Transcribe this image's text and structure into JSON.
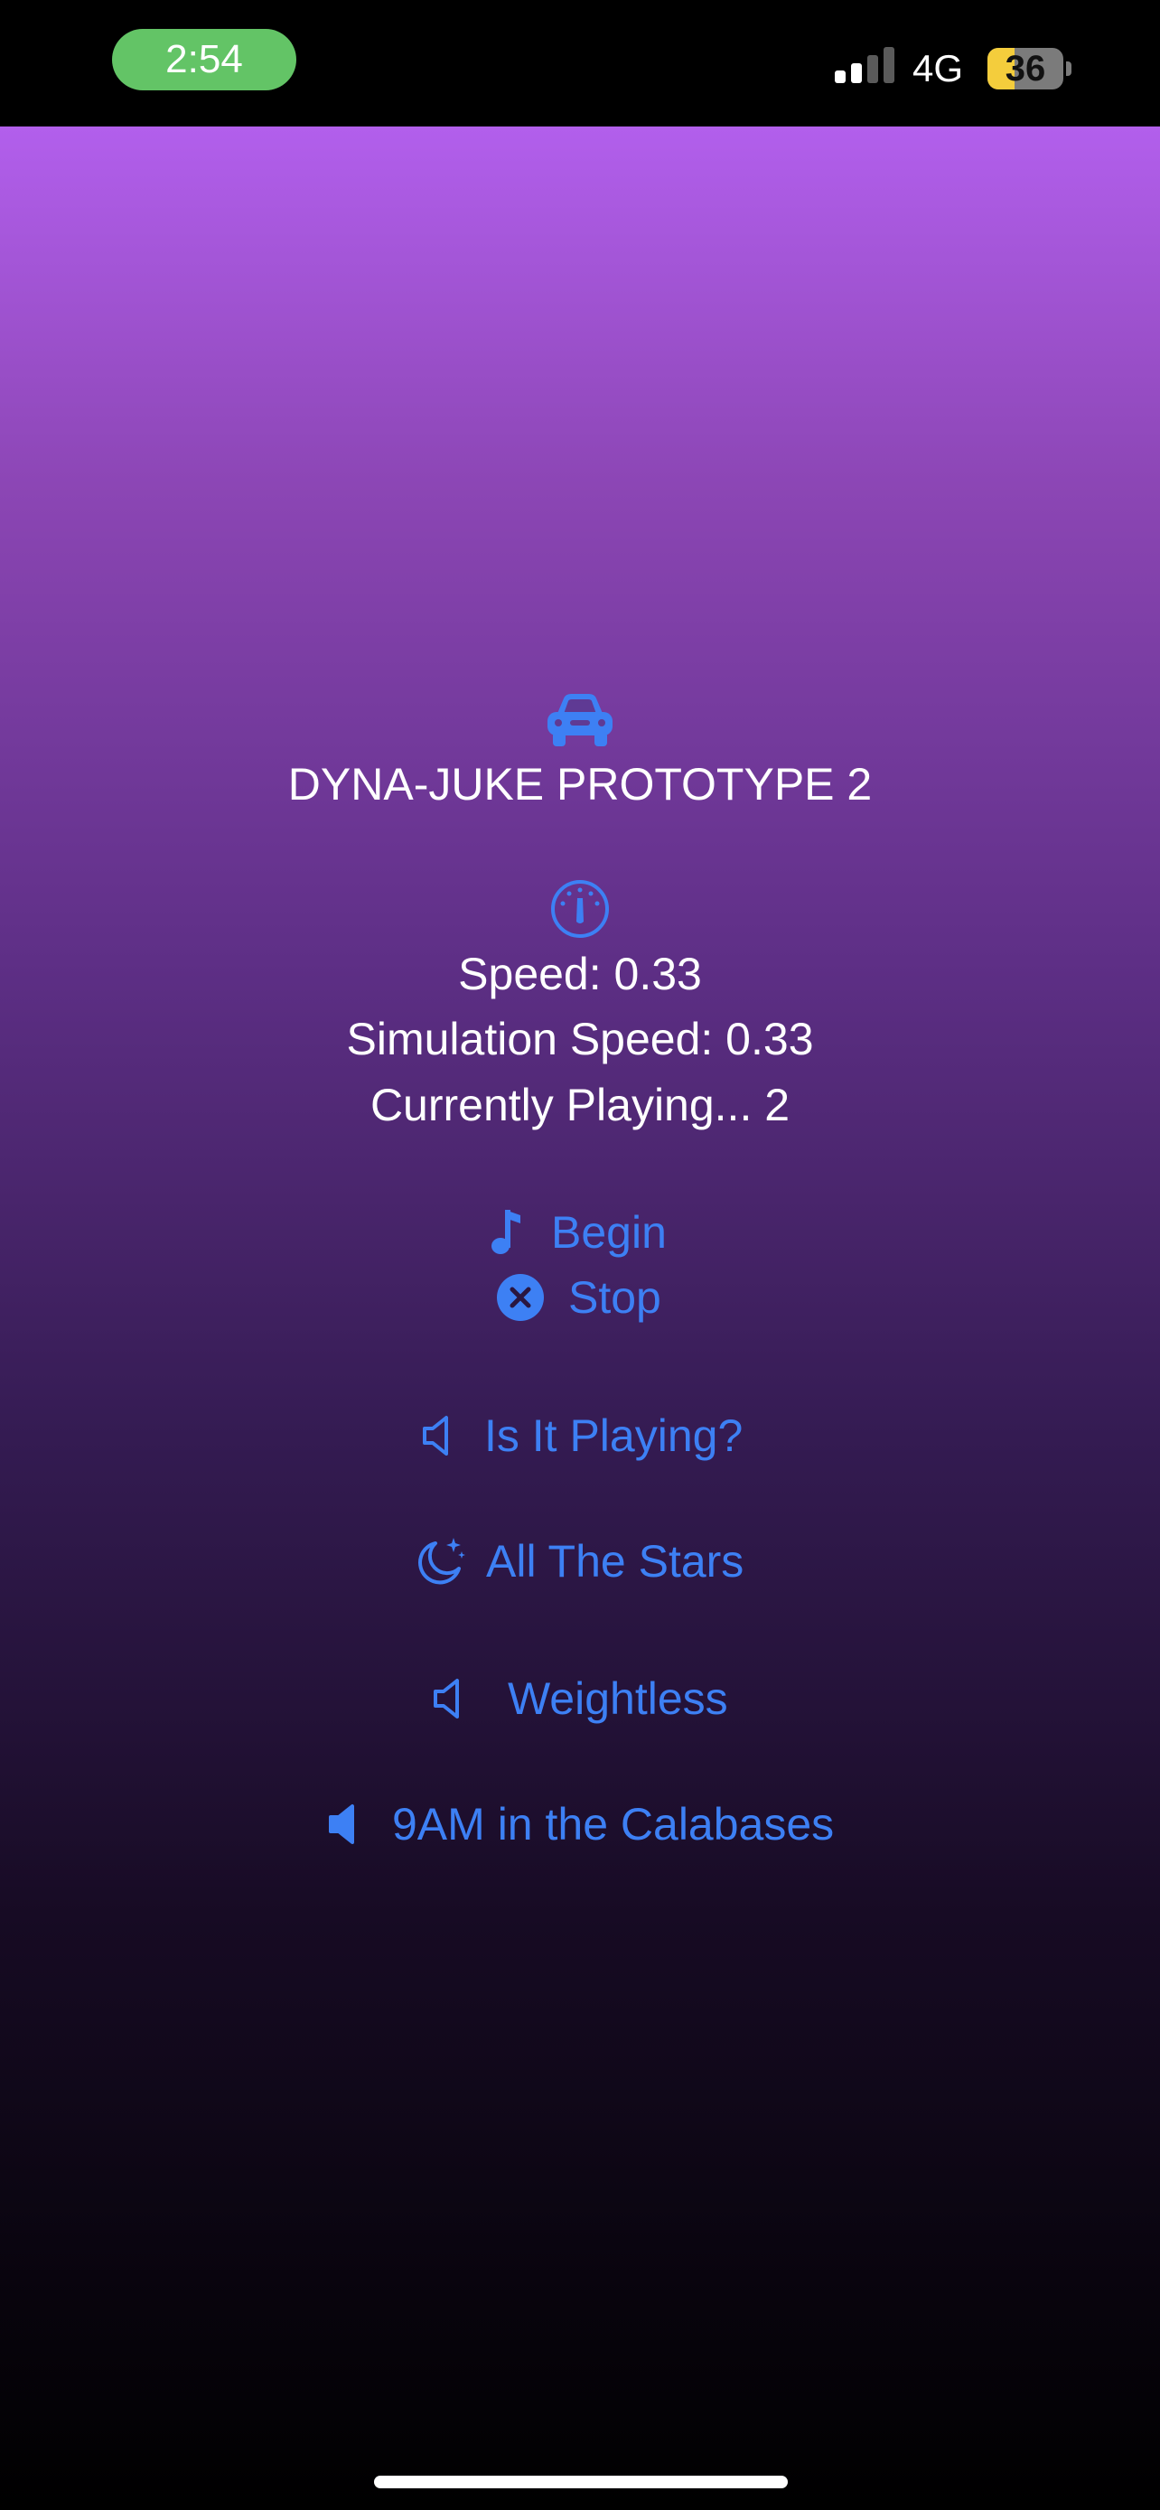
{
  "status_bar": {
    "time": "2:54",
    "network": "4G",
    "battery_level": "36"
  },
  "header": {
    "icon": "car-icon",
    "title": "DYNA-JUKE PROTOTYPE 2"
  },
  "stats": {
    "icon": "gauge-icon",
    "speed": "Speed: 0.33",
    "simulation_speed": "Simulation Speed: 0.33",
    "currently_playing": "Currently Playing... 2"
  },
  "controls": {
    "begin_label": "Begin",
    "begin_icon": "music-note-icon",
    "stop_label": "Stop",
    "stop_icon": "close-circle-icon"
  },
  "tracks": [
    {
      "label": "Is It Playing?",
      "icon": "speaker-outline-icon"
    },
    {
      "label": "All The Stars",
      "icon": "moon-stars-icon"
    },
    {
      "label": "Weightless",
      "icon": "speaker-outline-icon"
    },
    {
      "label": "9AM in the Calabases",
      "icon": "speaker-filled-icon"
    }
  ],
  "colors": {
    "accent": "#3d80f4",
    "time_pill": "#63c466",
    "battery": "#f4cd3c"
  }
}
